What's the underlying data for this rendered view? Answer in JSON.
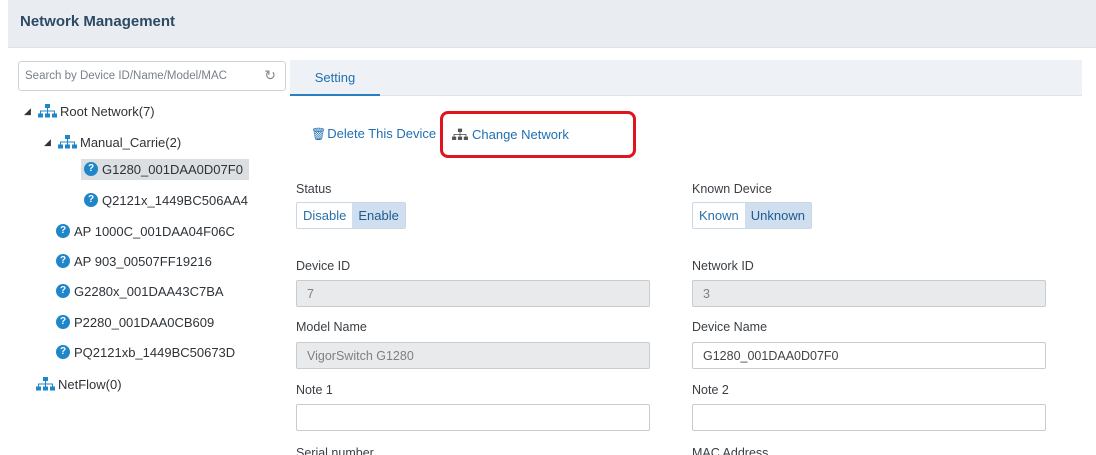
{
  "header": {
    "title": "Network Management"
  },
  "search": {
    "placeholder": "Search by Device ID/Name/Model/MAC"
  },
  "tree": {
    "root": "Root Network(7)",
    "group": "Manual_Carrie(2)",
    "group_items": [
      "G1280_001DAA0D07F0",
      "Q2121x_1449BC506AA4"
    ],
    "devices": [
      "AP 1000C_001DAA04F06C",
      "AP 903_00507FF19216",
      "G2280x_001DAA43C7BA",
      "P2280_001DAA0CB609",
      "PQ2121xb_1449BC50673D"
    ],
    "netflow": "NetFlow(0)"
  },
  "tabs": [
    "Setting"
  ],
  "actions": {
    "delete": "Delete This Device",
    "change": "Change Network"
  },
  "form": {
    "status": {
      "label": "Status",
      "options": [
        "Disable",
        "Enable"
      ],
      "selected": "Enable"
    },
    "known": {
      "label": "Known Device",
      "options": [
        "Known",
        "Unknown"
      ],
      "selected": "Unknown"
    },
    "device_id": {
      "label": "Device ID",
      "value": "7"
    },
    "network_id": {
      "label": "Network ID",
      "value": "3"
    },
    "model_name": {
      "label": "Model Name",
      "value": "VigorSwitch G1280"
    },
    "device_name": {
      "label": "Device Name",
      "value": "G1280_001DAA0D07F0"
    },
    "note1": {
      "label": "Note 1",
      "value": ""
    },
    "note2": {
      "label": "Note 2",
      "value": ""
    },
    "serial": {
      "label": "Serial number"
    },
    "mac": {
      "label": "MAC Address"
    }
  },
  "colors": {
    "accent": "#1f6fb2",
    "highlight": "#e0141e",
    "icon": "#1f86c9"
  }
}
